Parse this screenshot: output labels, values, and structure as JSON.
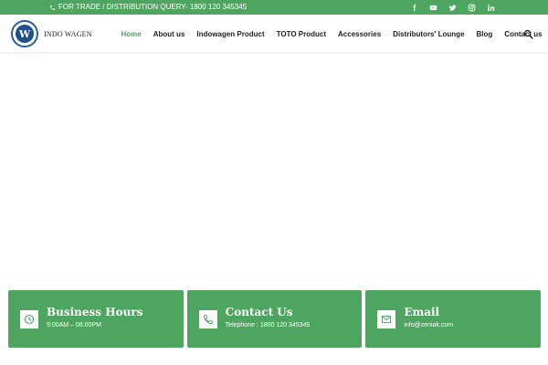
{
  "topbar": {
    "query_text": "FOR TRADE / DISTRIBUTION QUERY- 1800 120 345345",
    "social_icons": [
      "facebook-icon",
      "youtube-icon",
      "twitter-icon",
      "instagram-icon",
      "linkedin-icon"
    ]
  },
  "logo": {
    "letter": "W",
    "text": "INDO WAGEN"
  },
  "nav": {
    "items": [
      {
        "label": "Home",
        "active": true
      },
      {
        "label": "About us"
      },
      {
        "label": "Indowagen Product"
      },
      {
        "label": "TOTO Product"
      },
      {
        "label": "Accessories"
      },
      {
        "label": "Distributors' Lounge"
      },
      {
        "label": "Blog"
      },
      {
        "label": "Contact us"
      }
    ]
  },
  "cards": [
    {
      "title": "Business Hours",
      "sub": "9:00AM – 06:00PM",
      "icon": "clock-icon"
    },
    {
      "title": "Contact Us",
      "sub": "Telephone : 1800 120 345345",
      "icon": "phone-icon"
    },
    {
      "title": "Email",
      "sub": "info@zeniak.com",
      "icon": "envelope-icon"
    }
  ],
  "colors": {
    "brand_green": "#4ea560",
    "logo_blue": "#1f4f8c",
    "nav_text": "#222222"
  }
}
